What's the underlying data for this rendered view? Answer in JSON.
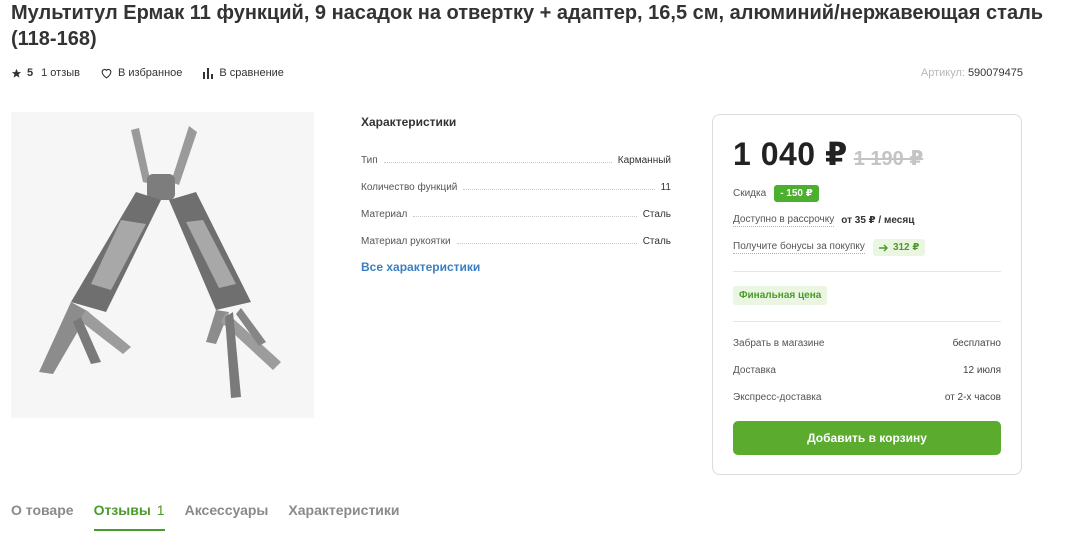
{
  "product": {
    "title": "Мультитул Ермак 11 функций, 9 насадок на отвертку + адаптер, 16,5 см, алюминий/нержавеющая сталь (118-168)",
    "rating": "5",
    "reviews": "1 отзыв",
    "favorites": "В избранное",
    "compare": "В сравнение",
    "article_label": "Артикул:",
    "article_value": "590079475"
  },
  "characteristics": {
    "title": "Характеристики",
    "rows": [
      {
        "name": "Тип",
        "value": "Карманный"
      },
      {
        "name": "Количество функций",
        "value": "11"
      },
      {
        "name": "Материал",
        "value": "Сталь"
      },
      {
        "name": "Материал рукоятки",
        "value": "Сталь"
      }
    ],
    "all_link": "Все характеристики"
  },
  "price": {
    "current": "1 040 ₽",
    "old": "1 190 ₽",
    "discount_label": "Скидка",
    "discount_value": "- 150 ₽",
    "installment_label": "Доступно в рассрочку",
    "installment_value": "от 35 ₽ / месяц",
    "bonus_label": "Получите бонусы за покупку",
    "bonus_value": "312 ₽",
    "final_label": "Финальная цена"
  },
  "delivery": [
    {
      "label": "Забрать в магазине",
      "value": "бесплатно"
    },
    {
      "label": "Доставка",
      "value": "12 июля"
    },
    {
      "label": "Экспресс-доставка",
      "value": "от 2-х часов"
    }
  ],
  "cart_button": "Добавить в корзину",
  "tabs": [
    {
      "label": "О товаре",
      "count": ""
    },
    {
      "label": "Отзывы",
      "count": "1"
    },
    {
      "label": "Аксессуары",
      "count": ""
    },
    {
      "label": "Характеристики",
      "count": ""
    }
  ],
  "colors": {
    "accent_green": "#5aab2e",
    "link_blue": "#3a7fc1"
  }
}
